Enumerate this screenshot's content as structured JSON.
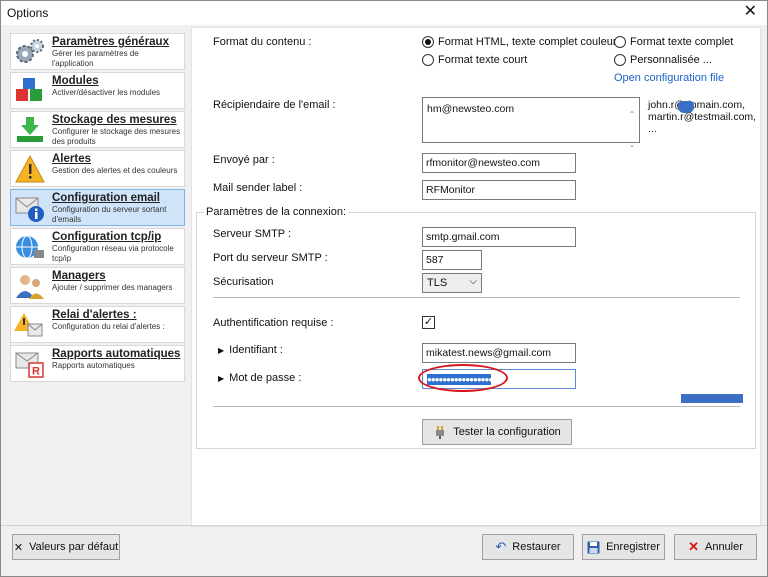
{
  "window": {
    "title": "Options"
  },
  "sidebar": {
    "items": [
      {
        "title": "Paramètres généraux",
        "desc": "Gérer les paramètres de l'application",
        "icon": "gears-icon"
      },
      {
        "title": "Modules",
        "desc": "Activer/désactiver les modules",
        "icon": "modules-icon"
      },
      {
        "title": "Stockage des mesures",
        "desc": "Configurer le stockage des mesures des produits",
        "icon": "download-icon"
      },
      {
        "title": "Alertes",
        "desc": "Gestion des alertes et des couleurs",
        "icon": "warning-icon"
      },
      {
        "title": "Configuration email",
        "desc": "Configuration du serveur sortant d'emails",
        "icon": "email-info-icon"
      },
      {
        "title": "Configuration tcp/ip",
        "desc": "Configuration réseau via protocole tcp/ip",
        "icon": "network-icon"
      },
      {
        "title": "Managers",
        "desc": "Ajouter / supprimer des managers",
        "icon": "users-icon"
      },
      {
        "title": "Relai d'alertes :",
        "desc": "Configuration du relai d'alertes :",
        "icon": "relay-icon"
      },
      {
        "title": "Rapports automatiques",
        "desc": "Rapports automatiques",
        "icon": "report-icon"
      }
    ]
  },
  "form": {
    "content_format_label": "Format du contenu :",
    "format_options": {
      "html": "Format HTML, texte complet couleurs",
      "full_text": "Format texte complet",
      "short_text": "Format texte court",
      "custom": "Personnalisée ..."
    },
    "open_config_link": "Open configuration file",
    "recipient_label": "Récipiendaire de l'email :",
    "recipient_value": "hm@newsteo.com",
    "recipient_hint": "john.r@domain.com, martin.r@testmail.com, ...",
    "sent_by_label": "Envoyé par :",
    "sent_by_value": "rfmonitor@newsteo.com",
    "sender_label_label": "Mail sender label :",
    "sender_label_value": "RFMonitor",
    "connection_group_label": "Paramètres de la connexion:",
    "smtp_server_label": "Serveur SMTP :",
    "smtp_server_value": "smtp.gmail.com",
    "smtp_port_label": "Port du serveur SMTP :",
    "smtp_port_value": "587",
    "security_label": "Sécurisation",
    "security_value": "TLS",
    "auth_label": "Authentification requise :",
    "auth_checked": true,
    "identifier_label": "Identifiant :",
    "identifier_value": "mikatest.news@gmail.com",
    "password_label": "Mot de passe :",
    "password_mask": "●●●●●●●●●●●●●●●●●●",
    "test_button": "Tester la configuration"
  },
  "footer": {
    "defaults_button": "Valeurs par défaut",
    "restore_button": "Restaurer",
    "save_button": "Enregistrer",
    "cancel_button": "Annuler"
  },
  "colors": {
    "accent": "#1a62c8",
    "selection": "#2f6fd0",
    "highlight_oval": "#d81818",
    "active_nav": "#cfe4f8"
  }
}
